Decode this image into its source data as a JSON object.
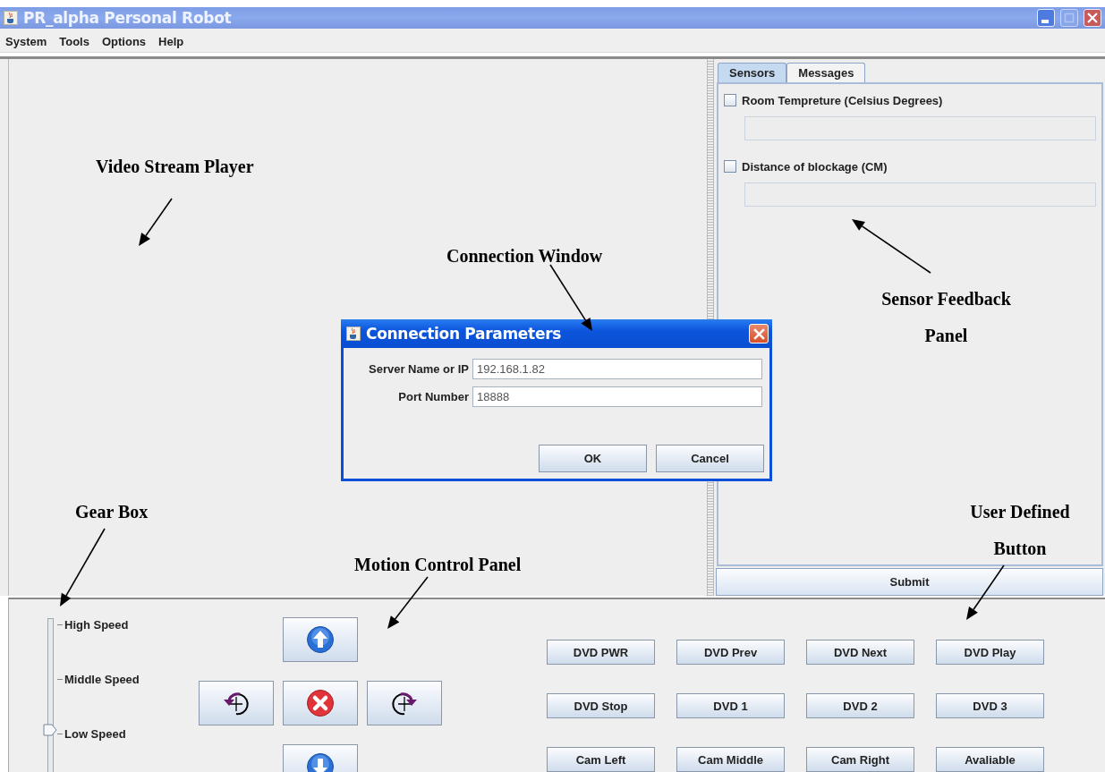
{
  "window": {
    "title": "PR_alpha Personal Robot"
  },
  "menu": [
    "System",
    "Tools",
    "Options",
    "Help"
  ],
  "sensors_panel": {
    "tabs": [
      {
        "label": "Sensors",
        "selected": true
      },
      {
        "label": "Messages",
        "selected": false
      }
    ],
    "sensors": [
      {
        "label": "Room Tempreture (Celsius Degrees)",
        "checked": false
      },
      {
        "label": "Distance of blockage (CM)",
        "checked": false
      }
    ],
    "submit": "Submit"
  },
  "gear_box": {
    "level": 0.33,
    "labels": [
      "High Speed",
      "Middle Speed",
      "Low Speed"
    ]
  },
  "motion_buttons": [
    {
      "kind": "forward"
    },
    {
      "kind": "rotate_left"
    },
    {
      "kind": "stop"
    },
    {
      "kind": "rotate_right"
    },
    {
      "kind": "backward"
    }
  ],
  "user_buttons": [
    "DVD PWR",
    "DVD Prev",
    "DVD Next",
    "DVD Play",
    "DVD Stop",
    "DVD 1",
    "DVD 2",
    "DVD 3",
    "Cam Left",
    "Cam Middle",
    "Cam Right",
    "Avaliable"
  ],
  "dialog": {
    "title": "Connection Parameters",
    "fields": [
      {
        "label": "Server Name or IP",
        "value": "192.168.1.82"
      },
      {
        "label": "Port Number",
        "value": "18888"
      }
    ],
    "buttons": [
      "OK",
      "Cancel"
    ]
  },
  "annotations": [
    "Video Stream Player",
    "Connection Window",
    "Sensor Feedback Panel",
    "Gear Box",
    "Motion Control Panel",
    "User Defined Button"
  ]
}
